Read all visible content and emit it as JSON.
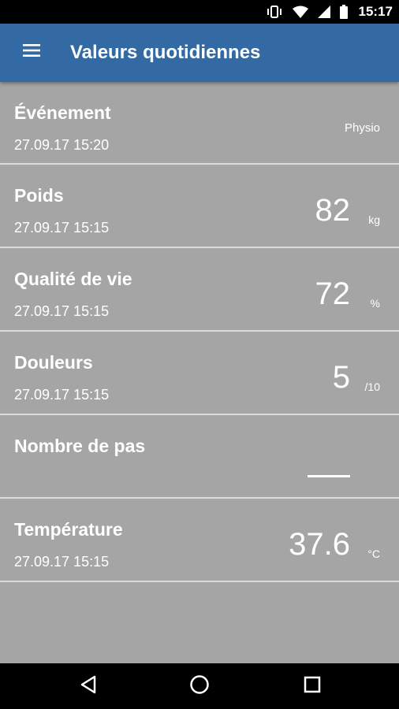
{
  "status_bar": {
    "time": "15:17",
    "icons": [
      "vibrate-icon",
      "wifi-icon",
      "signal-icon",
      "battery-icon"
    ]
  },
  "app_bar": {
    "title": "Valeurs quotidiennes",
    "menu_icon": "hamburger-menu-icon",
    "color": "#336aa3"
  },
  "entries": [
    {
      "name": "Événement",
      "date": "27.09.17 15:20",
      "tag": "Physio"
    },
    {
      "name": "Poids",
      "date": "27.09.17 15:15",
      "value": "82",
      "unit": "kg"
    },
    {
      "name": "Qualité de vie",
      "date": "27.09.17 15:15",
      "value": "72",
      "unit": "%"
    },
    {
      "name": "Douleurs",
      "date": "27.09.17 15:15",
      "value": "5",
      "unit": "/10"
    },
    {
      "name": "Nombre de pas",
      "date": "",
      "value": null,
      "empty_indicator": "dash"
    },
    {
      "name": "Température",
      "date": "27.09.17 15:15",
      "value": "37.6",
      "unit": "°C"
    }
  ],
  "nav_bar": {
    "buttons": [
      "back-icon",
      "home-icon",
      "recents-icon"
    ]
  },
  "colors": {
    "background": "#a5a5a5",
    "divider": "#dcdcdc",
    "text": "#ffffff"
  }
}
